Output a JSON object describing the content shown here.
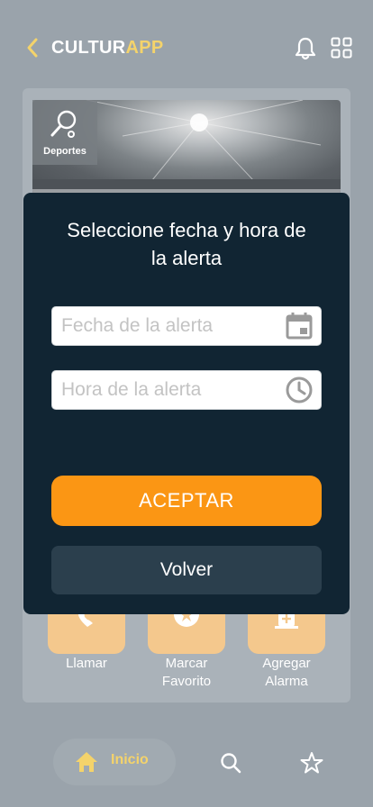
{
  "header": {
    "brand_part1": "CULTUR",
    "brand_part2": "APP",
    "icons": [
      "chevron-left-icon",
      "bell-icon",
      "grid-icon"
    ]
  },
  "event": {
    "category": "Deportes",
    "category_icon": "racket-icon"
  },
  "actions": [
    {
      "label_line1": "Llamar",
      "label_line2": "",
      "icon": "phone-icon"
    },
    {
      "label_line1": "Marcar",
      "label_line2": "Favorito",
      "icon": "star-icon"
    },
    {
      "label_line1": "Agregar",
      "label_line2": "Alarma",
      "icon": "alarm-add-icon"
    }
  ],
  "modal": {
    "title_line1": "Seleccione fecha y hora de",
    "title_line2": "la alerta",
    "date_placeholder": "Fecha de la alerta",
    "time_placeholder": "Hora de la alerta",
    "accept_label": "ACEPTAR",
    "back_label": "Volver"
  },
  "bottom_nav": {
    "home_label": "Inicio",
    "items": [
      "home-icon",
      "search-icon",
      "star-icon"
    ]
  },
  "colors": {
    "brand_yellow": "#f4d36b",
    "accent_orange": "#fb9614",
    "modal_bg": "#112533",
    "overlay_bg": "#9aa3ab"
  }
}
